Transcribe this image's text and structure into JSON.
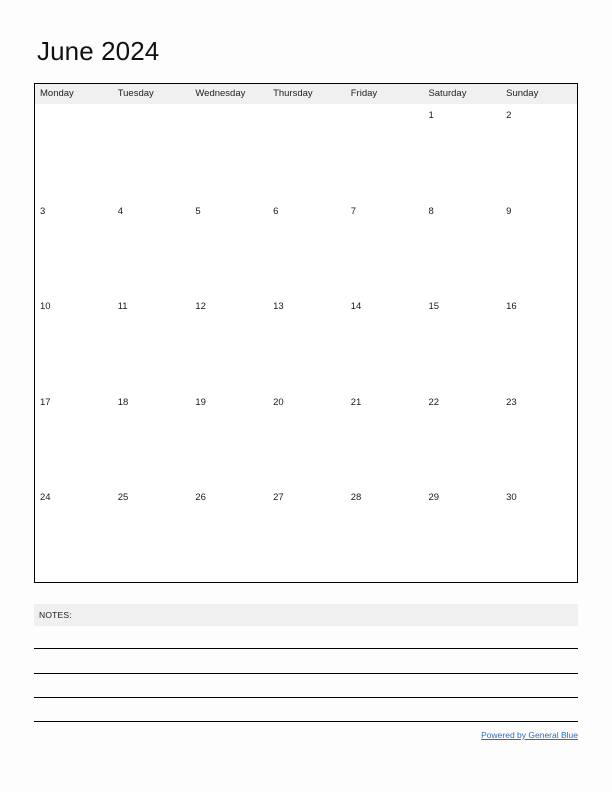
{
  "document": {
    "title": "June 2024",
    "month": "June",
    "year": "2024",
    "page_background": "#fdfdfd",
    "border_color": "#000000",
    "header_background": "#f0f0f0"
  },
  "calendar": {
    "weekday_headers": [
      "Monday",
      "Tuesday",
      "Wednesday",
      "Thursday",
      "Friday",
      "Saturday",
      "Sunday"
    ],
    "weeks": [
      {
        "days": [
          "",
          "",
          "",
          "",
          "",
          "1",
          "2"
        ]
      },
      {
        "days": [
          "3",
          "4",
          "5",
          "6",
          "7",
          "8",
          "9"
        ]
      },
      {
        "days": [
          "10",
          "11",
          "12",
          "13",
          "14",
          "15",
          "16"
        ]
      },
      {
        "days": [
          "17",
          "18",
          "19",
          "20",
          "21",
          "22",
          "23"
        ]
      },
      {
        "days": [
          "24",
          "25",
          "26",
          "27",
          "28",
          "29",
          "30"
        ]
      }
    ]
  },
  "notes": {
    "label": "NOTES:",
    "line_count": 4
  },
  "footer": {
    "link_text": "Powered by General Blue",
    "link_color": "#2a6ebb"
  }
}
